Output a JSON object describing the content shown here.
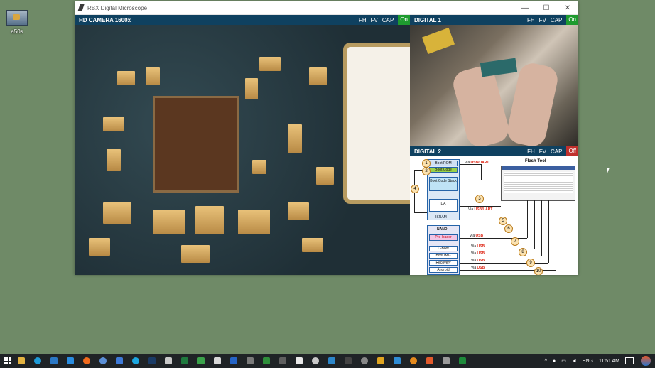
{
  "desktop": {
    "icon_label": "a50s"
  },
  "window": {
    "title": "RBX Digital Microscope",
    "minimize": "—",
    "maximize": "☐",
    "close": "✕"
  },
  "panels": {
    "main": {
      "title": "HD CAMERA 1600x",
      "fh": "FH",
      "fv": "FV",
      "cap": "CAP",
      "state": "On"
    },
    "d1": {
      "title": "DIGITAL 1",
      "fh": "FH",
      "fv": "FV",
      "cap": "CAP",
      "state": "On"
    },
    "d2": {
      "title": "DIGITAL 2",
      "fh": "FH",
      "fv": "FV",
      "cap": "CAP",
      "state": "Off"
    }
  },
  "diagram": {
    "flash_tool": "Flash Tool",
    "boot_rom": "Boot ROM",
    "boot_code": "Boot Code",
    "boot_code_stack": "Boot Code Stack",
    "da": "DA",
    "isram": "ISRAM",
    "nand": "NAND",
    "preloader": "Pre-loader",
    "uboot": "U-Boot",
    "bootimg": "Boot IMG",
    "recovery": "Recovery",
    "android": "Android",
    "via_word": "Via",
    "usb_uart": "USB/UART",
    "usb": "USB",
    "numbers": [
      "1",
      "2",
      "3",
      "4",
      "5",
      "6",
      "7",
      "8",
      "9",
      "10"
    ]
  },
  "taskbar": {
    "lang": "ENG",
    "time": "11:51 AM",
    "apps": [
      "folder",
      "edge",
      "mail",
      "vscode",
      "firefox",
      "chrome",
      "browser",
      "skype",
      "photoshop",
      "doc",
      "excel",
      "app",
      "app",
      "app",
      "app",
      "app",
      "app",
      "app",
      "app",
      "app",
      "app",
      "app",
      "app",
      "app",
      "app",
      "app",
      "app",
      "app",
      "app",
      "app",
      "app"
    ]
  }
}
